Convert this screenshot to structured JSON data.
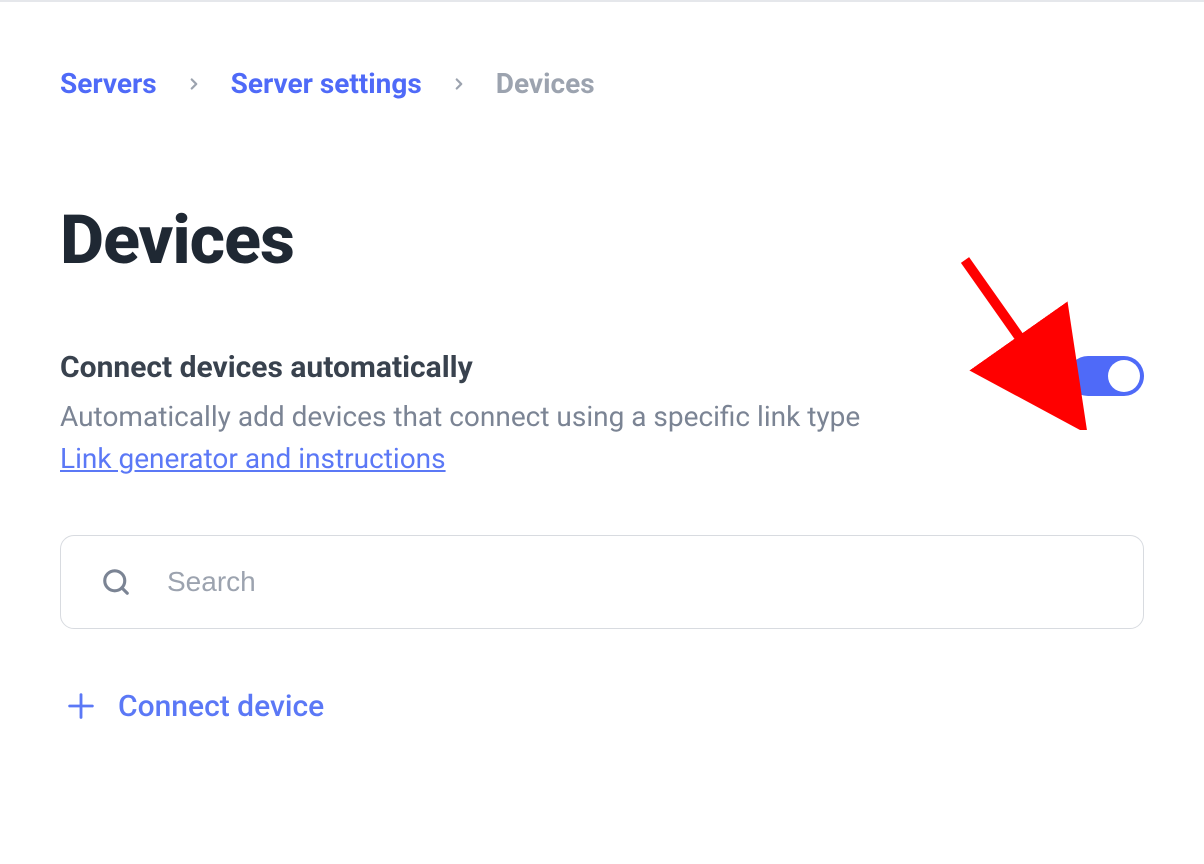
{
  "breadcrumb": {
    "items": [
      {
        "label": "Servers",
        "active": false
      },
      {
        "label": "Server settings",
        "active": false
      },
      {
        "label": "Devices",
        "active": true
      }
    ]
  },
  "page": {
    "title": "Devices"
  },
  "setting": {
    "title": "Connect devices automatically",
    "description": "Automatically add devices that connect using a specific link type",
    "link_label": "Link generator and instructions",
    "toggle_on": true
  },
  "search": {
    "placeholder": "Search",
    "value": ""
  },
  "actions": {
    "connect_device_label": "Connect device"
  },
  "colors": {
    "accent": "#4f6af8",
    "link": "#5b78f6",
    "text_dark": "#1f2833",
    "text_muted": "#7b8494",
    "border": "#d8dbe0"
  }
}
